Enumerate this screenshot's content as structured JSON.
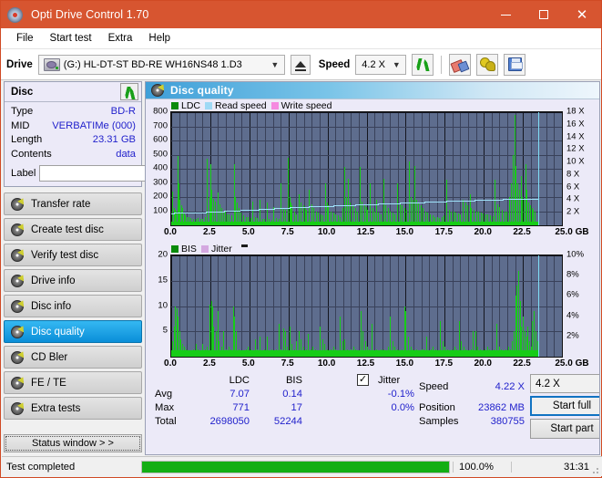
{
  "window": {
    "title": "Opti Drive Control 1.70",
    "app_icon": "disc-icon",
    "minimize": "minimize-icon",
    "maximize": "maximize-icon",
    "close": "close-icon"
  },
  "menu": [
    {
      "label": "File"
    },
    {
      "label": "Start test"
    },
    {
      "label": "Extra"
    },
    {
      "label": "Help"
    }
  ],
  "toolbar": {
    "drive_label": "Drive",
    "drive_value": "(G:)  HL-DT-ST BD-RE  WH16NS48 1.D3",
    "eject_icon": "eject-icon",
    "speed_label": "Speed",
    "speed_value": "4.2 X",
    "refresh_icon": "refresh-icon",
    "eraser_icon": "eraser-icon",
    "plug_icon": "plug-icon",
    "save_icon": "save-icon"
  },
  "disc_panel": {
    "title": "Disc",
    "refresh_icon": "refresh-icon",
    "rows": [
      {
        "key": "Type",
        "value": "BD-R"
      },
      {
        "key": "MID",
        "value": "VERBATIMe (000)"
      },
      {
        "key": "Length",
        "value": "23.31 GB"
      },
      {
        "key": "Contents",
        "value": "data"
      }
    ],
    "label_key": "Label",
    "label_value": "",
    "label_placeholder": "",
    "label_button_icon": "cd-icon"
  },
  "sidebar": {
    "items": [
      {
        "label": "Transfer rate",
        "active": false
      },
      {
        "label": "Create test disc",
        "active": false
      },
      {
        "label": "Verify test disc",
        "active": false
      },
      {
        "label": "Drive info",
        "active": false
      },
      {
        "label": "Disc info",
        "active": false
      },
      {
        "label": "Disc quality",
        "active": true
      },
      {
        "label": "CD Bler",
        "active": false
      },
      {
        "label": "FE / TE",
        "active": false
      },
      {
        "label": "Extra tests",
        "active": false
      }
    ],
    "status_window_button": "Status window > >"
  },
  "content": {
    "title": "Disc quality",
    "title_icon": "disc-quality-icon"
  },
  "stats": {
    "col_ldc": "LDC",
    "col_bis": "BIS",
    "row_avg": "Avg",
    "row_max": "Max",
    "row_total": "Total",
    "ldc_avg": "7.07",
    "ldc_max": "771",
    "ldc_total": "2698050",
    "bis_avg": "0.14",
    "bis_max": "17",
    "bis_total": "52244",
    "jitter_label": "Jitter",
    "jitter_checked": true,
    "jitter_avg": "-0.1%",
    "jitter_max": "0.0%",
    "speed_label": "Speed",
    "speed_value": "4.22 X",
    "position_label": "Position",
    "position_value": "23862 MB",
    "samples_label": "Samples",
    "samples_value": "380755",
    "speed_select": "4.2 X",
    "start_full": "Start full",
    "start_part": "Start part"
  },
  "statusbar": {
    "message": "Test completed",
    "percent_label": "100.0%",
    "percent_value": 100,
    "time": "31:31"
  },
  "chart_data": [
    {
      "type": "bar",
      "title": "Disc quality - LDC",
      "xlabel": "GB",
      "ylabel": "LDC",
      "xlim": [
        0,
        25
      ],
      "ylim": [
        0,
        800
      ],
      "y2lim": [
        0,
        18
      ],
      "y2label": "X",
      "grid": true,
      "legend_position": "top-left",
      "legend": [
        {
          "name": "LDC",
          "color": "#0a8a0a"
        },
        {
          "name": "Read speed",
          "color": "#9fd9f5"
        },
        {
          "name": "Write speed",
          "color": "#f58ae0"
        }
      ],
      "xticks": [
        "0.0",
        "2.5",
        "5.0",
        "7.5",
        "10.0",
        "12.5",
        "15.0",
        "17.5",
        "20.0",
        "22.5",
        "25.0"
      ],
      "yticks": [
        100,
        200,
        300,
        400,
        500,
        600,
        700,
        800
      ],
      "y2ticks": [
        "2 X",
        "4 X",
        "6 X",
        "8 X",
        "10 X",
        "12 X",
        "14 X",
        "16 X",
        "18 X"
      ],
      "data_end_gb": 23.5,
      "cursor_gb": 23.5,
      "series": [
        {
          "name": "LDC",
          "color": "#17cc17",
          "x": [
            0.05,
            0.15,
            0.25,
            0.3,
            0.38,
            0.45,
            0.5,
            0.55,
            0.62,
            0.7,
            0.8,
            0.9,
            1.0,
            1.1,
            1.25,
            1.4,
            1.55,
            1.7,
            1.85,
            2.0,
            2.15,
            2.3,
            2.42,
            2.5,
            2.58,
            2.66,
            2.8,
            2.95,
            3.1,
            3.2,
            3.3,
            3.42,
            3.55,
            3.7,
            3.85,
            4.0,
            4.1,
            4.18,
            4.3,
            4.45,
            4.6,
            4.75,
            4.9,
            5.05,
            5.2,
            5.35,
            5.5,
            5.65,
            5.8,
            5.95,
            6.1,
            6.25,
            6.4,
            6.55,
            6.7,
            6.85,
            7.0,
            7.15,
            7.3,
            7.45,
            7.55,
            7.62,
            7.7,
            7.85,
            8.0,
            8.15,
            8.3,
            8.45,
            8.55,
            8.65,
            8.8,
            8.95,
            9.1,
            9.25,
            9.4,
            9.55,
            9.7,
            9.85,
            9.95,
            10.05,
            10.2,
            10.35,
            10.5,
            10.65,
            10.8,
            10.95,
            11.1,
            11.2,
            11.3,
            11.45,
            11.6,
            11.75,
            11.9,
            12.05,
            12.2,
            12.35,
            12.45,
            12.55,
            12.7,
            12.85,
            13.0,
            13.1,
            13.25,
            13.4,
            13.55,
            13.7,
            13.85,
            14.0,
            14.15,
            14.3,
            14.45,
            14.6,
            14.75,
            14.9,
            15.05,
            15.2,
            15.3,
            15.45,
            15.55,
            15.65,
            15.8,
            15.95,
            16.1,
            16.25,
            16.4,
            16.55,
            16.7,
            16.85,
            17.0,
            17.15,
            17.3,
            17.45,
            17.6,
            17.75,
            17.9,
            18.05,
            18.2,
            18.35,
            18.5,
            18.65,
            18.8,
            18.95,
            19.1,
            19.2,
            19.35,
            19.5,
            19.65,
            19.8,
            19.95,
            20.1,
            20.25,
            20.4,
            20.55,
            20.7,
            20.85,
            21.0,
            21.15,
            21.3,
            21.45,
            21.6,
            21.75,
            21.85,
            21.95,
            22.05,
            22.15,
            22.25,
            22.35,
            22.45,
            22.55,
            22.65,
            22.75,
            22.85,
            22.95,
            23.05,
            23.15,
            23.25,
            23.35,
            23.45
          ],
          "values": [
            240,
            120,
            110,
            95,
            490,
            300,
            180,
            160,
            145,
            120,
            90,
            70,
            60,
            55,
            50,
            45,
            48,
            52,
            46,
            44,
            60,
            470,
            200,
            430,
            250,
            190,
            170,
            230,
            150,
            120,
            100,
            95,
            80,
            75,
            70,
            430,
            200,
            160,
            120,
            90,
            70,
            60,
            55,
            52,
            170,
            60,
            50,
            180,
            48,
            46,
            160,
            44,
            42,
            130,
            50,
            48,
            300,
            120,
            110,
            480,
            200,
            160,
            140,
            100,
            80,
            220,
            160,
            140,
            120,
            110,
            250,
            150,
            120,
            100,
            90,
            80,
            70,
            300,
            160,
            140,
            100,
            90,
            80,
            70,
            60,
            120,
            410,
            200,
            330,
            160,
            140,
            120,
            100,
            410,
            170,
            150,
            130,
            110,
            300,
            120,
            100,
            180,
            90,
            80,
            330,
            140,
            120,
            100,
            90,
            80,
            300,
            160,
            140,
            120,
            110,
            450,
            200,
            180,
            420,
            180,
            160,
            140,
            120,
            100,
            90,
            80,
            70,
            60,
            55,
            50,
            60,
            70,
            320,
            110,
            100,
            95,
            90,
            85,
            80,
            180,
            160,
            140,
            220,
            120,
            110,
            100,
            95,
            90,
            85,
            80,
            75,
            70,
            65,
            320,
            150,
            130,
            110,
            100,
            95,
            200,
            300,
            500,
            780,
            420,
            300,
            250,
            350,
            200,
            180,
            430,
            250,
            160,
            140,
            120,
            110,
            100
          ]
        },
        {
          "name": "Read speed",
          "color": "#9fe2fa",
          "x": [
            0.0,
            2.0,
            4.0,
            6.0,
            8.0,
            10.0,
            12.0,
            14.0,
            16.0,
            18.0,
            20.0,
            22.0,
            23.5
          ],
          "values_x": [
            1.95,
            2.1,
            2.35,
            2.6,
            2.9,
            3.1,
            3.3,
            3.5,
            3.7,
            3.9,
            4.05,
            4.2,
            4.22
          ]
        }
      ]
    },
    {
      "type": "bar",
      "title": "Disc quality - BIS",
      "xlabel": "GB",
      "ylabel": "BIS",
      "xlim": [
        0,
        25
      ],
      "ylim": [
        0,
        20
      ],
      "y2lim": [
        0,
        10
      ],
      "y2label": "%",
      "grid": true,
      "legend_position": "top-left",
      "legend": [
        {
          "name": "BIS",
          "color": "#0a8a0a"
        },
        {
          "name": "Jitter",
          "color": "#d4a8e0"
        }
      ],
      "xticks": [
        "0.0",
        "2.5",
        "5.0",
        "7.5",
        "10.0",
        "12.5",
        "15.0",
        "17.5",
        "20.0",
        "22.5",
        "25.0"
      ],
      "yticks": [
        5,
        10,
        15,
        20
      ],
      "y2ticks": [
        "2%",
        "4%",
        "6%",
        "8%",
        "10%"
      ],
      "data_end_gb": 23.5,
      "cursor_gb": 23.5,
      "series": [
        {
          "name": "BIS",
          "color": "#17cc17",
          "x": [
            0.05,
            0.15,
            0.25,
            0.35,
            0.42,
            0.5,
            0.6,
            0.7,
            0.8,
            0.95,
            1.1,
            1.25,
            1.4,
            1.55,
            1.7,
            1.85,
            2.0,
            2.15,
            2.3,
            2.45,
            2.55,
            2.62,
            2.7,
            2.85,
            2.95,
            3.05,
            3.2,
            3.35,
            3.5,
            3.65,
            3.8,
            3.95,
            4.05,
            4.15,
            4.3,
            4.45,
            4.6,
            4.75,
            4.9,
            5.05,
            5.2,
            5.35,
            5.5,
            5.65,
            5.8,
            5.95,
            6.1,
            6.25,
            6.4,
            6.55,
            6.7,
            6.85,
            7.0,
            7.15,
            7.3,
            7.4,
            7.55,
            7.7,
            7.85,
            8.0,
            8.15,
            8.3,
            8.45,
            8.6,
            8.75,
            8.9,
            9.05,
            9.2,
            9.35,
            9.5,
            9.65,
            9.8,
            9.95,
            10.05,
            10.2,
            10.35,
            10.5,
            10.65,
            10.8,
            10.95,
            11.1,
            11.25,
            11.35,
            11.5,
            11.65,
            11.8,
            11.95,
            12.1,
            12.25,
            12.4,
            12.5,
            12.65,
            12.8,
            12.95,
            13.1,
            13.25,
            13.4,
            13.55,
            13.7,
            13.85,
            14.0,
            14.15,
            14.3,
            14.45,
            14.6,
            14.75,
            14.9,
            15.0,
            15.15,
            15.3,
            15.45,
            15.6,
            15.7,
            15.85,
            16.0,
            16.15,
            16.3,
            16.45,
            16.6,
            16.75,
            16.9,
            17.05,
            17.2,
            17.35,
            17.5,
            17.65,
            17.8,
            17.95,
            18.1,
            18.25,
            18.4,
            18.55,
            18.7,
            18.85,
            19.0,
            19.15,
            19.3,
            19.45,
            19.6,
            19.75,
            19.9,
            20.05,
            20.2,
            20.35,
            20.5,
            20.65,
            20.8,
            20.95,
            21.1,
            21.25,
            21.4,
            21.55,
            21.7,
            21.8,
            21.9,
            22.0,
            22.1,
            22.2,
            22.3,
            22.4,
            22.5,
            22.6,
            22.7,
            22.8,
            22.9,
            23.0,
            23.1,
            23.2,
            23.3,
            23.4
          ],
          "values": [
            3.0,
            6.0,
            10.0,
            9.5,
            8.0,
            5.0,
            3.5,
            2.5,
            2.0,
            1.5,
            1.3,
            1.2,
            1.5,
            2.5,
            1.4,
            1.3,
            2.5,
            1.5,
            2.0,
            10.2,
            11.0,
            10.0,
            6.0,
            5.0,
            9.0,
            3.0,
            2.0,
            5.0,
            1.5,
            2.0,
            1.5,
            10.0,
            8.0,
            5.0,
            1.5,
            1.3,
            1.2,
            1.5,
            2.0,
            1.5,
            1.3,
            3.5,
            1.5,
            4.0,
            1.2,
            1.5,
            4.0,
            1.3,
            1.5,
            1.2,
            1.4,
            6.5,
            1.5,
            5.5,
            5.0,
            2.0,
            6.0,
            2.5,
            1.5,
            3.0,
            5.0,
            3.5,
            2.0,
            1.5,
            4.5,
            1.5,
            2.0,
            1.5,
            1.3,
            6.0,
            3.5,
            2.5,
            1.5,
            1.3,
            1.5,
            2.0,
            1.5,
            1.3,
            8.0,
            3.0,
            3.5,
            1.5,
            1.3,
            1.5,
            2.0,
            1.5,
            1.3,
            9.0,
            5.0,
            3.0,
            2.0,
            1.5,
            6.5,
            1.3,
            1.5,
            1.2,
            1.4,
            1.5,
            1.3,
            2.0,
            8.0,
            3.0,
            2.0,
            1.5,
            1.3,
            1.5,
            10.0,
            9.0,
            4.0,
            2.0,
            1.5,
            1.3,
            1.5,
            1.2,
            1.4,
            1.5,
            4.0,
            1.3,
            1.5,
            2.0,
            1.5,
            1.3,
            7.0,
            3.0,
            2.0,
            1.5,
            1.3,
            1.5,
            2.0,
            1.5,
            7.0,
            3.0,
            2.0,
            1.5,
            1.3,
            1.5,
            5.0,
            5.0,
            2.0,
            1.5,
            1.3,
            1.5,
            2.0,
            1.5,
            1.3,
            1.5,
            6.5,
            2.0,
            1.5,
            1.3,
            1.5,
            2.0,
            1.5,
            3.0,
            5.0,
            12.0,
            14.0,
            17.0,
            11.0,
            6.0,
            8.0,
            5.0,
            4.0,
            6.0,
            3.0,
            2.0,
            7.0,
            9.0,
            5.0,
            3.0,
            2.0,
            1.5
          ]
        }
      ]
    }
  ]
}
